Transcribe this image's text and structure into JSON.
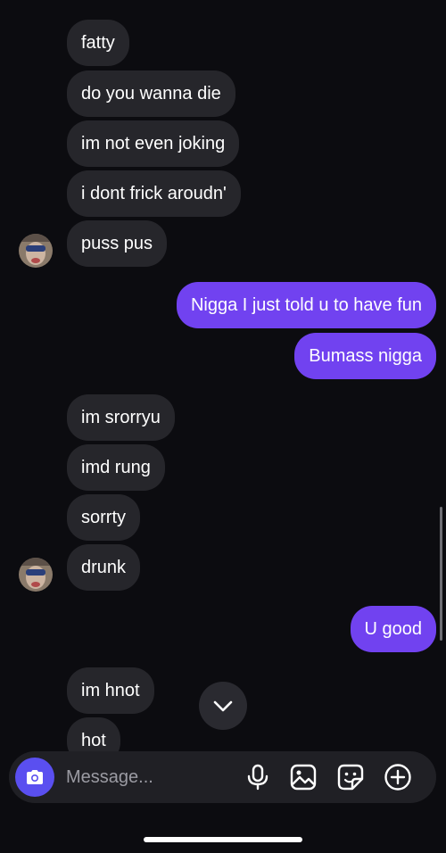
{
  "thread": {
    "messages": [
      {
        "side": "in",
        "text": "fatty"
      },
      {
        "side": "in",
        "text": "do you wanna die"
      },
      {
        "side": "in",
        "text": "im not even joking"
      },
      {
        "side": "in",
        "text": "i dont frick aroudn'"
      },
      {
        "side": "in",
        "text": "puss pus"
      },
      {
        "side": "out",
        "text": "Nigga I just told u to have fun"
      },
      {
        "side": "out",
        "text": "Bumass nigga"
      },
      {
        "side": "in",
        "text": "im srorryu"
      },
      {
        "side": "in",
        "text": "imd rung"
      },
      {
        "side": "in",
        "text": "sorrty"
      },
      {
        "side": "in",
        "text": "drunk"
      },
      {
        "side": "out",
        "text": "U good"
      },
      {
        "side": "in",
        "text": "im hnot"
      },
      {
        "side": "in",
        "text": "hot"
      }
    ]
  },
  "composer": {
    "placeholder": "Message...",
    "icons": [
      "camera-icon",
      "microphone-icon",
      "gallery-icon",
      "sticker-icon",
      "plus-icon"
    ]
  },
  "colors": {
    "background": "#0c0c10",
    "incoming_bubble": "#26262b",
    "outgoing_bubble": "#7142f0",
    "camera_button": "#5a4ff0"
  }
}
